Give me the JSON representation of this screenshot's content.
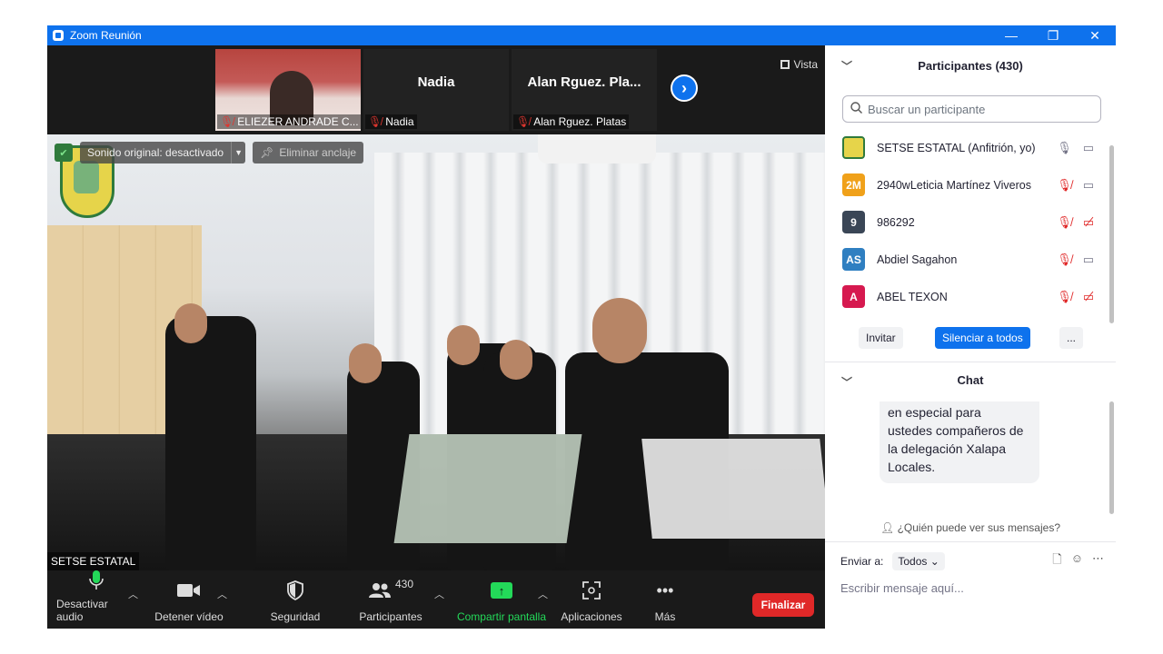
{
  "window": {
    "title": "Zoom Reunión",
    "controls": {
      "minimize": "—",
      "restore": "❐",
      "close": "✕"
    }
  },
  "strip": {
    "tiles": [
      {
        "label": "ELIEZER ANDRADE C..."
      },
      {
        "name": "Nadia",
        "label": "Nadia"
      },
      {
        "name": "Alan  Rguez. Pla...",
        "label": "Alan  Rguez. Platas"
      }
    ],
    "view_label": "Vista",
    "next_icon": "›"
  },
  "main_video": {
    "sound_label": "Sonido original: desactivado",
    "unpin_label": "Eliminar anclaje",
    "name_tag": "SETSE ESTATAL"
  },
  "toolbar": {
    "mute_label": "Desactivar audio",
    "video_label": "Detener vídeo",
    "security_label": "Seguridad",
    "participants_label": "Participantes",
    "participants_count": "430",
    "share_label": "Compartir pantalla",
    "apps_label": "Aplicaciones",
    "more_label": "Más",
    "end_label": "Finalizar",
    "colors": {
      "share": "#23d959",
      "end": "#e02828"
    }
  },
  "participants_panel": {
    "title": "Participantes (430)",
    "search_placeholder": "Buscar un participante",
    "list": [
      {
        "initials": "",
        "name": "SETSE ESTATAL (Anfitrión, yo)",
        "color": "#e6d44a",
        "mic": "on",
        "cam": "on"
      },
      {
        "initials": "2M",
        "name": "2940wLeticia Martínez Viveros",
        "color": "#f0a11a",
        "mic": "off",
        "cam": "on"
      },
      {
        "initials": "9",
        "name": "986292",
        "color": "#3a4656",
        "mic": "off",
        "cam": "off"
      },
      {
        "initials": "AS",
        "name": "Abdiel Sagahon",
        "color": "#2f7fc1",
        "mic": "off",
        "cam": "on"
      },
      {
        "initials": "A",
        "name": "ABEL TEXON",
        "color": "#d6194f",
        "mic": "off",
        "cam": "off"
      }
    ],
    "invite_label": "Invitar",
    "mute_all_label": "Silenciar a todos",
    "more_label": "..."
  },
  "chat": {
    "title": "Chat",
    "message_lines": [
      "en especial para",
      "ustedes compañeros de",
      "la delegación Xalapa",
      "Locales."
    ],
    "who_can_see": "¿Quién puede ver sus mensajes?",
    "send_to_label": "Enviar a:",
    "recipient": "Todos",
    "input_placeholder": "Escribir mensaje aquí..."
  }
}
